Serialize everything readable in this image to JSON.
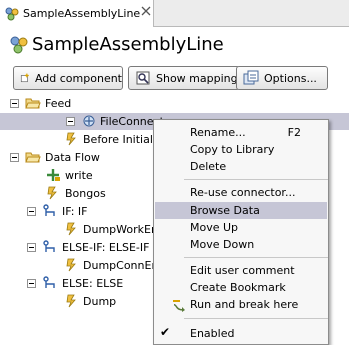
{
  "tab": {
    "title": "SampleAssemblyLine"
  },
  "editor": {
    "title": "SampleAssemblyLine"
  },
  "toolbar": {
    "add_component": "Add component",
    "show_mapping": "Show mapping",
    "options": "Options..."
  },
  "tree": {
    "feed": "Feed",
    "file_connector": "FileConnector",
    "before_initialize": "Before Initialize",
    "data_flow": "Data Flow",
    "write": "write",
    "bongos": "Bongos",
    "if_if": "IF: IF",
    "dump_work_entry": "DumpWorkEntry",
    "else_if": "ELSE-IF: ELSE-IF",
    "dump_conn_entry": "DumpConnEntry",
    "else_else": "ELSE: ELSE",
    "dump": "Dump"
  },
  "context_menu": {
    "rename": "Rename...",
    "rename_shortcut": "F2",
    "copy_to_library": "Copy to Library",
    "delete": "Delete",
    "reuse_connector": "Re-use connector...",
    "browse_data": "Browse Data",
    "move_up": "Move Up",
    "move_down": "Move Down",
    "edit_user_comment": "Edit user comment",
    "create_bookmark": "Create Bookmark",
    "run_and_break_here": "Run and break here",
    "enabled": "Enabled",
    "enabled_checked": "✔"
  },
  "colors": {
    "selection": "#c6c6d6",
    "folder": "#e8c35a",
    "script": "#d4a017",
    "branch": "#2f5fa8"
  }
}
